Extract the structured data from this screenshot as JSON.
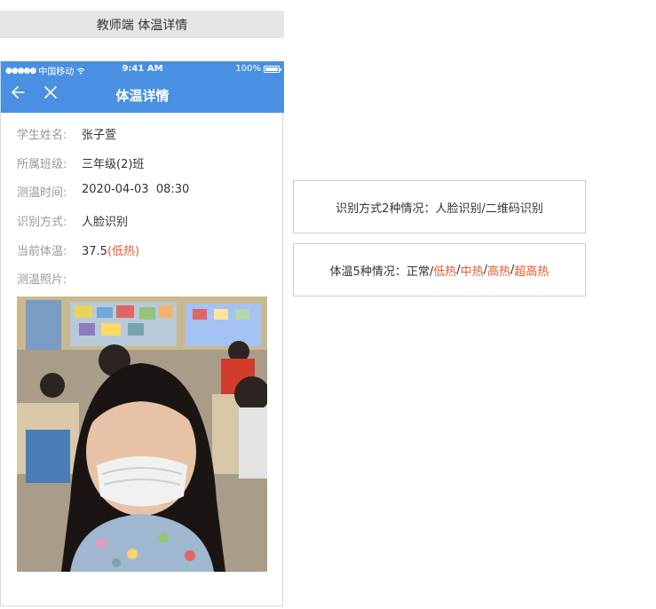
{
  "page_label": "教师端 体温详情",
  "statusbar": {
    "dots": "●●●●●",
    "carrier": "中国移动",
    "time": "9:41 AM",
    "battery_text": "100%",
    "battery_level": 1.0
  },
  "navbar": {
    "title": "体温详情"
  },
  "fields": {
    "name_label": "学生姓名:",
    "name_value": "张子萱",
    "class_label": "所属班级:",
    "class_value": "三年级(2)班",
    "time_label": "测温时间:",
    "time_value": "2020-04-03  08:30",
    "method_label": "识别方式:",
    "method_value": "人脸识别",
    "temp_label": "当前体温:",
    "temp_value": "37.5",
    "temp_open": "(",
    "temp_status": "低热",
    "temp_close": ")",
    "photo_label": "测温照片:"
  },
  "notes": {
    "method_note": "识别方式2种情况：人脸识别/二维码识别",
    "temp_note_prefix": "体温5种情况：正常/",
    "levels": [
      "低热",
      "中热",
      "高热",
      "超高热"
    ],
    "sep": "/"
  },
  "colors": {
    "nav": "#4a90e2",
    "alert": "#e8572b"
  }
}
